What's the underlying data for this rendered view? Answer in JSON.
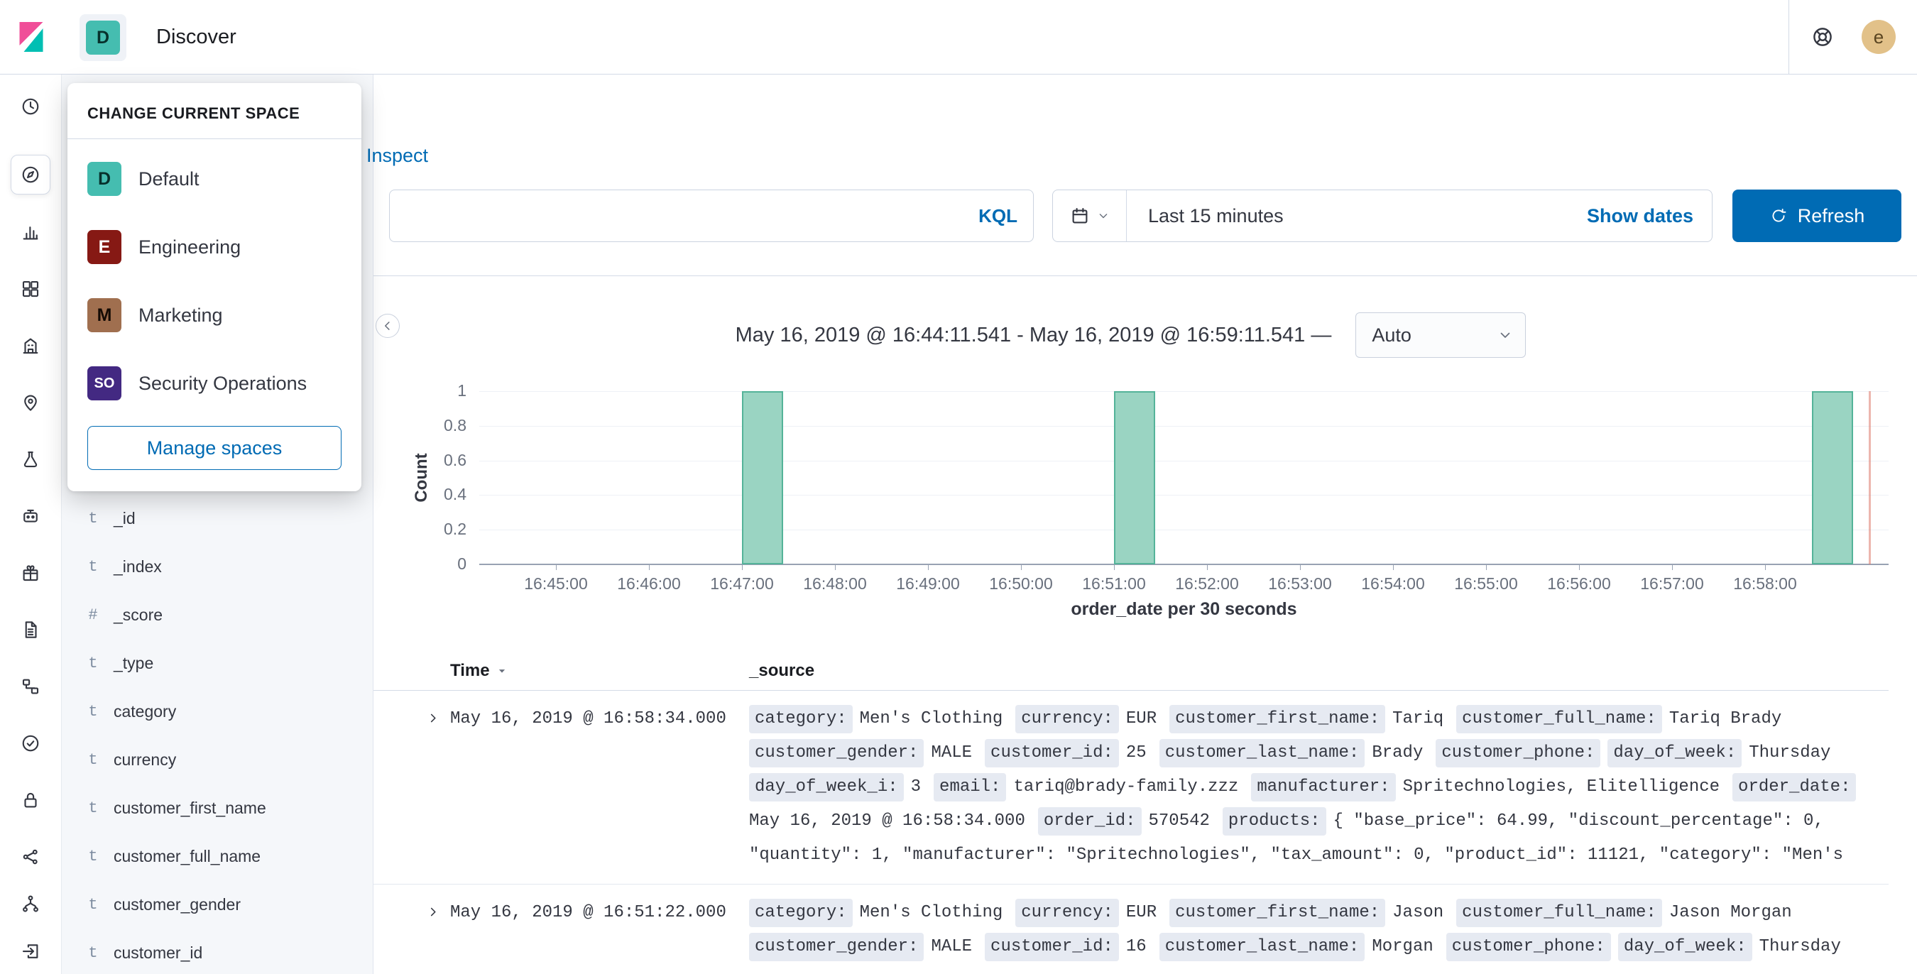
{
  "topbar": {
    "breadcrumb": "Discover",
    "space_initial": "D",
    "user_initial": "e",
    "user_avatar_color": "#E2C189",
    "user_avatar_text_color": "#5A4521"
  },
  "nav": {
    "icons": [
      {
        "icon": "clock"
      },
      {
        "icon": "compass",
        "selected": true
      },
      {
        "icon": "bar-chart"
      },
      {
        "icon": "grid"
      },
      {
        "icon": "building"
      },
      {
        "icon": "map-pin"
      },
      {
        "icon": "flask"
      },
      {
        "icon": "robot"
      },
      {
        "icon": "gift"
      },
      {
        "icon": "document"
      },
      {
        "icon": "hierarchy"
      },
      {
        "icon": "check-circle"
      },
      {
        "icon": "lock"
      },
      {
        "icon": "share-nodes"
      },
      {
        "icon": "fork"
      },
      {
        "icon": "exit-arrow"
      }
    ]
  },
  "space_popover": {
    "title": "CHANGE CURRENT SPACE",
    "spaces": [
      {
        "initial": "D",
        "name": "Default",
        "color": "#45BDB0",
        "text_color": "#07312C"
      },
      {
        "initial": "E",
        "name": "Engineering",
        "color": "#861914",
        "text_color": "#FFFFFF"
      },
      {
        "initial": "M",
        "name": "Marketing",
        "color": "#A06F4F",
        "text_color": "#140B05"
      },
      {
        "initial": "SO",
        "name": "Security Operations",
        "color": "#432982",
        "text_color": "#FFFFFF"
      }
    ],
    "manage_label": "Manage spaces"
  },
  "app_menu": {
    "inspect_label": "Inspect"
  },
  "query_bar": {
    "kql_label": "KQL",
    "time_range": "Last 15 minutes",
    "show_dates_label": "Show dates",
    "refresh_label": "Refresh"
  },
  "sidebar": {
    "fields": [
      {
        "type": "t",
        "name": "_id"
      },
      {
        "type": "t",
        "name": "_index"
      },
      {
        "type": "#",
        "name": "_score"
      },
      {
        "type": "t",
        "name": "_type"
      },
      {
        "type": "t",
        "name": "category"
      },
      {
        "type": "t",
        "name": "currency"
      },
      {
        "type": "t",
        "name": "customer_first_name"
      },
      {
        "type": "t",
        "name": "customer_full_name"
      },
      {
        "type": "t",
        "name": "customer_gender"
      },
      {
        "type": "t",
        "name": "customer_id"
      }
    ]
  },
  "chart_data": {
    "type": "bar",
    "title": "May 16, 2019 @ 16:44:11.541 - May 16, 2019 @ 16:59:11.541 —",
    "interval_label": "Auto",
    "ylabel": "Count",
    "xlabel": "order_date per 30 seconds",
    "ylim": [
      0,
      1
    ],
    "yticks": [
      0,
      0.2,
      0.4,
      0.6,
      0.8,
      1
    ],
    "x_ticks": [
      "16:45:00",
      "16:46:00",
      "16:47:00",
      "16:48:00",
      "16:49:00",
      "16:50:00",
      "16:51:00",
      "16:52:00",
      "16:53:00",
      "16:54:00",
      "16:55:00",
      "16:56:00",
      "16:57:00",
      "16:58:00"
    ],
    "x_range": [
      "16:44:11.541",
      "16:59:11.541"
    ],
    "bucket_seconds": 30,
    "bars": [
      {
        "time": "16:47:00",
        "count": 1
      },
      {
        "time": "16:51:00",
        "count": 1
      },
      {
        "time": "16:58:30",
        "count": 1
      }
    ],
    "end_marker_time": "16:59:07",
    "bar_color": "#9AD4C2",
    "bar_border_color": "#54B399",
    "end_marker_color": "#DD7A6C"
  },
  "table": {
    "time_header": "Time",
    "source_header": "_source",
    "rows": [
      {
        "time": "May 16, 2019 @ 16:58:34.000",
        "source": [
          {
            "field": "category",
            "value": "Men's Clothing"
          },
          {
            "field": "currency",
            "value": "EUR"
          },
          {
            "field": "customer_first_name",
            "value": "Tariq"
          },
          {
            "field": "customer_full_name",
            "value": "Tariq Brady"
          },
          {
            "field": "customer_gender",
            "value": "MALE"
          },
          {
            "field": "customer_id",
            "value": "25"
          },
          {
            "field": "customer_last_name",
            "value": "Brady"
          },
          {
            "field": "customer_phone",
            "value": ""
          },
          {
            "field": "day_of_week",
            "value": "Thursday"
          },
          {
            "field": "day_of_week_i",
            "value": "3"
          },
          {
            "field": "email",
            "value": "tariq@brady-family.zzz"
          },
          {
            "field": "manufacturer",
            "value": "Spritechnologies, Elitelligence"
          },
          {
            "field": "order_date",
            "value": "May 16, 2019 @ 16:58:34.000"
          },
          {
            "field": "order_id",
            "value": "570542"
          },
          {
            "field": "products",
            "value": "{ \"base_price\": 64.99, \"discount_percentage\": 0, \"quantity\": 1, \"manufacturer\": \"Spritechnologies\", \"tax_amount\": 0, \"product_id\": 11121, \"category\": \"Men's"
          }
        ]
      },
      {
        "time": "May 16, 2019 @ 16:51:22.000",
        "source": [
          {
            "field": "category",
            "value": "Men's Clothing"
          },
          {
            "field": "currency",
            "value": "EUR"
          },
          {
            "field": "customer_first_name",
            "value": "Jason"
          },
          {
            "field": "customer_full_name",
            "value": "Jason Morgan"
          },
          {
            "field": "customer_gender",
            "value": "MALE"
          },
          {
            "field": "customer_id",
            "value": "16"
          },
          {
            "field": "customer_last_name",
            "value": "Morgan"
          },
          {
            "field": "customer_phone",
            "value": ""
          },
          {
            "field": "day_of_week",
            "value": "Thursday"
          }
        ]
      }
    ]
  }
}
